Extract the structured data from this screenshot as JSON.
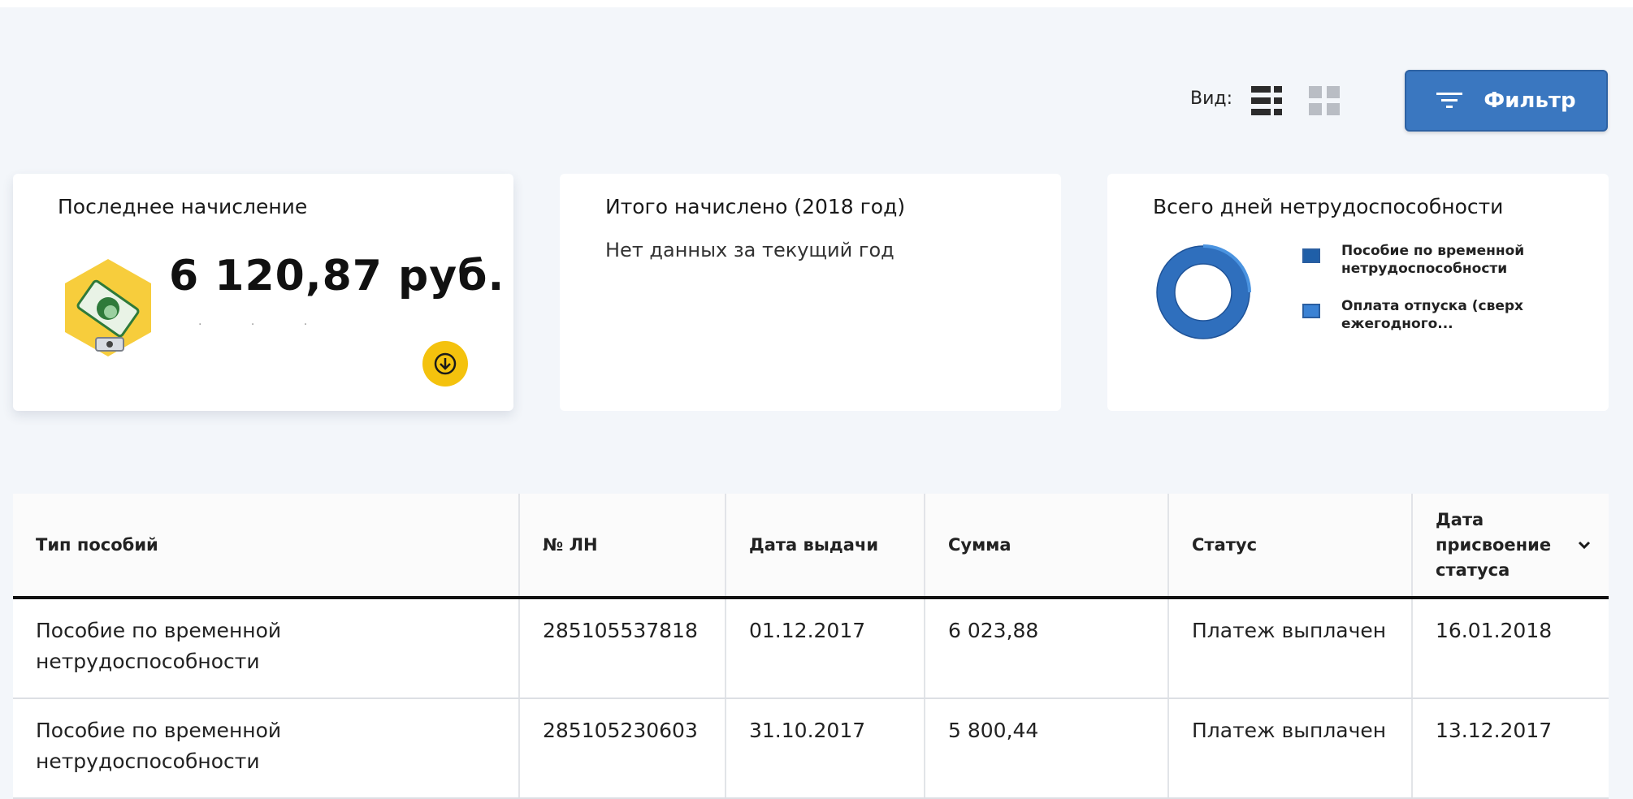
{
  "toolbar": {
    "view_label": "Вид:",
    "list_view_icon": "list-view-icon",
    "grid_view_icon": "grid-view-icon",
    "filter_label": "Фильтр",
    "filter_icon": "filter-icon",
    "accent_color": "#3a77c0"
  },
  "cards": {
    "last_accrual": {
      "title": "Последнее начисление",
      "amount": "6 120,87 руб.",
      "icon": "money-icon",
      "download_icon": "download-arrow-icon",
      "download_color": "#f4c20d"
    },
    "total_accrued": {
      "title": "Итого начислено (2018 год)",
      "message": "Нет данных за текущий год"
    },
    "total_days": {
      "title": "Всего дней нетрудоспособности",
      "legend": [
        {
          "label": "Пособие по временной нетрудоспособности",
          "color": "#1f5fa8"
        },
        {
          "label": "Оплата отпуска (сверх ежегодного...",
          "color": "#3b82d4"
        }
      ]
    }
  },
  "table": {
    "columns": [
      "Тип пособий",
      "№ ЛН",
      "Дата выдачи",
      "Сумма",
      "Статус",
      "Дата присвоение статуса"
    ],
    "sort_icon": "chevron-down-icon",
    "rows": [
      [
        "Пособие по временной нетрудоспособности",
        "285105537818",
        "01.12.2017",
        "6 023,88",
        "Платеж выплачен",
        "16.01.2018"
      ],
      [
        "Пособие по временной нетрудоспособности",
        "285105230603",
        "31.10.2017",
        "5 800,44",
        "Платеж выплачен",
        "13.12.2017"
      ]
    ]
  }
}
